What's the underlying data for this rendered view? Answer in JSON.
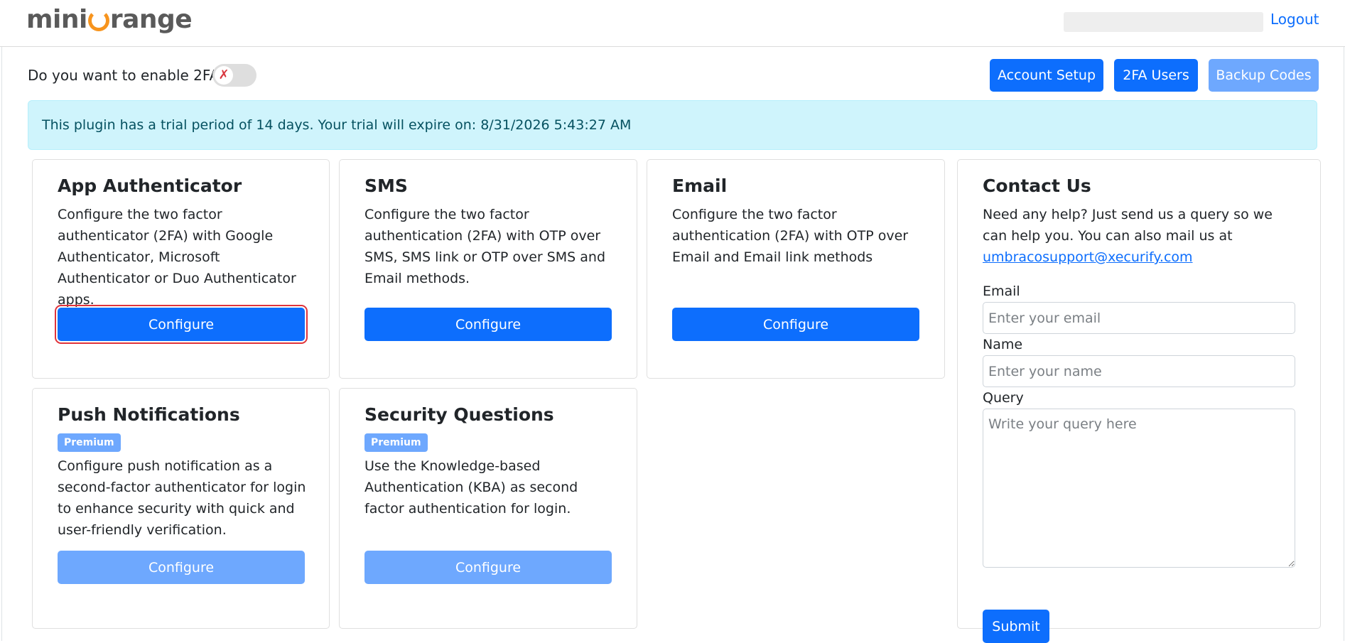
{
  "header": {
    "logo_prefix": "mini",
    "logo_suffix": "range",
    "logout_label": "Logout"
  },
  "settings": {
    "enable_2fa_label": "Do you want to enable 2FA:",
    "toggle_icon": "✗",
    "toggle_enabled": false
  },
  "top_buttons": {
    "account_setup": "Account Setup",
    "users_2fa": "2FA Users",
    "backup_codes": "Backup Codes"
  },
  "alert": {
    "text": "This plugin has a trial period of 14 days. Your trial will expire on: 8/31/2026 5:43:27 AM"
  },
  "methods": [
    {
      "title": "App Authenticator",
      "description": "Configure the two factor authenticator (2FA) with Google Authenticator, Microsoft Authenticator or Duo Authenticator apps.",
      "button": "Configure"
    },
    {
      "title": "SMS",
      "description": "Configure the two factor authentication (2FA) with OTP over SMS, SMS link or OTP over SMS and Email methods.",
      "button": "Configure"
    },
    {
      "title": "Email",
      "description": "Configure the two factor authentication (2FA) with OTP over Email and Email link methods",
      "button": "Configure"
    },
    {
      "title": "Push Notifications",
      "badge": "Premium",
      "description": "Configure push notification as a second-factor authenticator for login to enhance security with quick and user-friendly verification.",
      "button": "Configure"
    },
    {
      "title": "Security Questions",
      "badge": "Premium",
      "description": "Use the Knowledge-based Authentication (KBA) as second factor authentication for login.",
      "button": "Configure"
    }
  ],
  "contact": {
    "title": "Contact Us",
    "intro": "Need any help? Just send us a query so we can help you. You can also mail us at",
    "support_email": "umbracosupport@xecurify.com",
    "email_label": "Email",
    "email_placeholder": "Enter your email",
    "name_label": "Name",
    "name_placeholder": "Enter your name",
    "query_label": "Query",
    "query_placeholder": "Write your query here",
    "submit_label": "Submit"
  }
}
